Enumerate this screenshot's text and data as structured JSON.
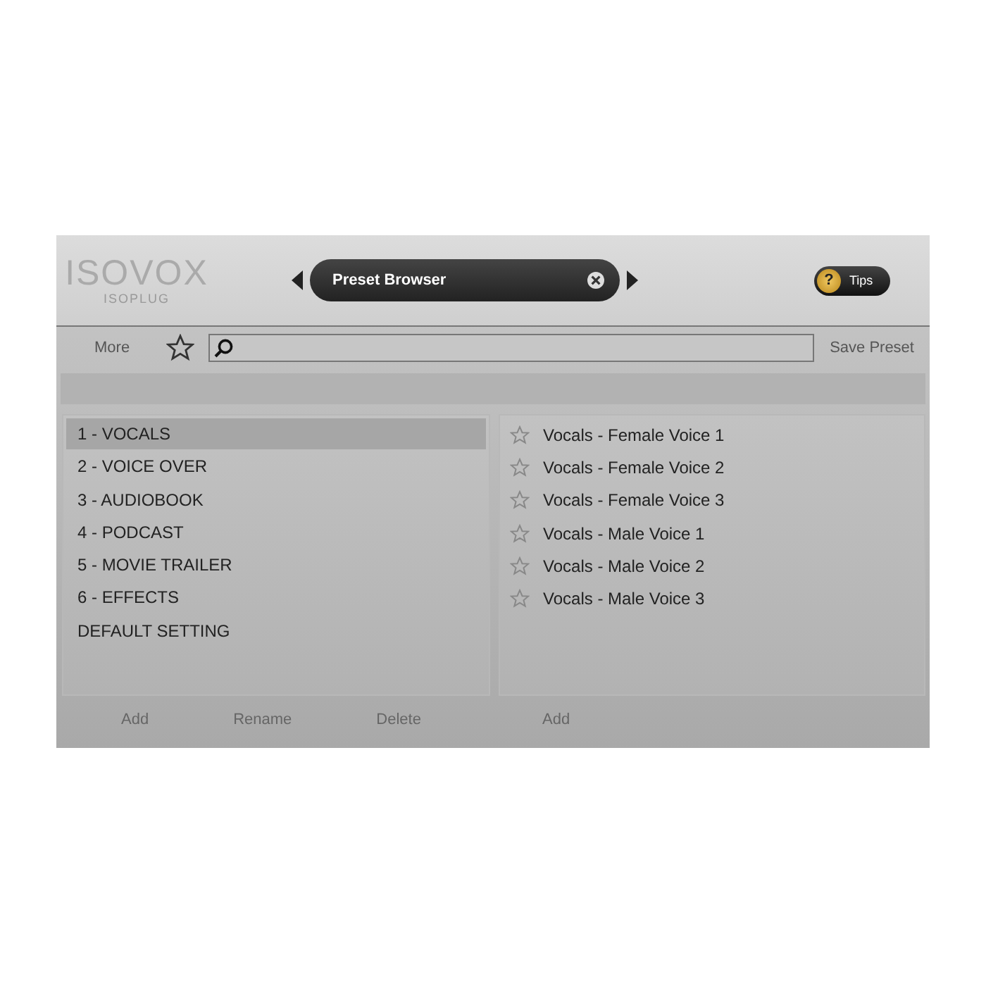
{
  "logo": {
    "name": "ISOVOX",
    "maker": "ISOPLUG"
  },
  "header": {
    "title": "Preset Browser",
    "tips": "Tips",
    "tips_glyph": "?"
  },
  "toolbar": {
    "more": "More",
    "save": "Save Preset"
  },
  "banks": [
    {
      "label": "1 - VOCALS",
      "selected": true
    },
    {
      "label": "2 - VOICE OVER",
      "selected": false
    },
    {
      "label": "3 - AUDIOBOOK",
      "selected": false
    },
    {
      "label": "4 - PODCAST",
      "selected": false
    },
    {
      "label": "5 - MOVIE TRAILER",
      "selected": false
    },
    {
      "label": "6 - EFFECTS",
      "selected": false
    },
    {
      "label": "DEFAULT SETTING",
      "selected": false
    }
  ],
  "presets": [
    {
      "label": "Vocals - Female Voice 1",
      "favorite": false
    },
    {
      "label": "Vocals - Female Voice 2",
      "favorite": false
    },
    {
      "label": "Vocals - Female Voice 3",
      "favorite": false
    },
    {
      "label": "Vocals - Male Voice 1",
      "favorite": false
    },
    {
      "label": "Vocals - Male Voice 2",
      "favorite": false
    },
    {
      "label": "Vocals - Male Voice 3",
      "favorite": false
    }
  ],
  "bank_buttons": [
    "Add",
    "Rename",
    "Delete"
  ],
  "preset_buttons": [
    "Add"
  ]
}
